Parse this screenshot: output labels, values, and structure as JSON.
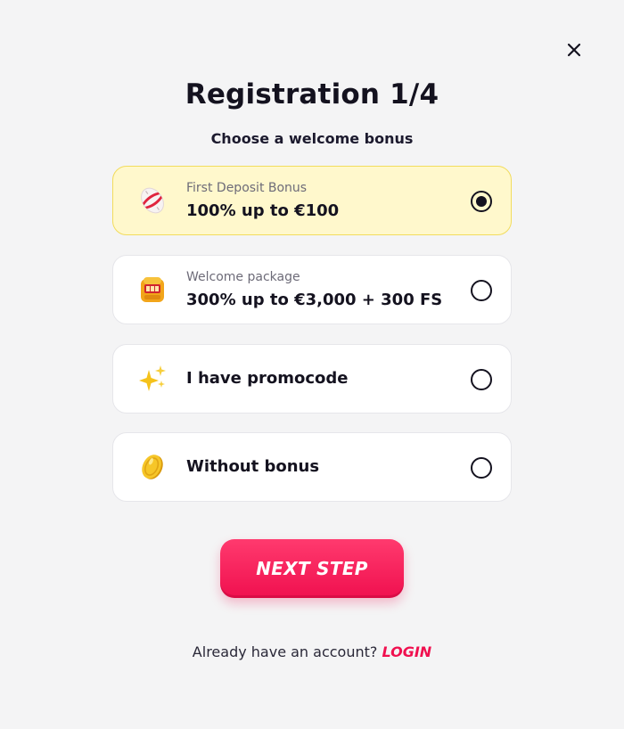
{
  "modal": {
    "title": "Registration 1/4",
    "subtitle": "Choose a welcome bonus",
    "close_icon": "close-icon"
  },
  "options": [
    {
      "icon": "football-icon",
      "small_label": "First Deposit Bonus",
      "label": "100% up to €100",
      "selected": true
    },
    {
      "icon": "slot-machine-icon",
      "small_label": "Welcome package",
      "label": "300% up to €3,000 + 300 FS",
      "selected": false
    },
    {
      "icon": "sparkles-icon",
      "label": "I have promocode",
      "selected": false
    },
    {
      "icon": "gold-coin-icon",
      "label": "Without bonus",
      "selected": false
    }
  ],
  "next_button": {
    "label": "NEXT STEP"
  },
  "footer": {
    "prompt": "Already have an account?",
    "login_label": "LOGIN"
  },
  "colors": {
    "accent": "#f0104f",
    "selected_bg": "#fff8cc",
    "selected_border": "#f2dc5d",
    "background": "#f4f4f5"
  }
}
